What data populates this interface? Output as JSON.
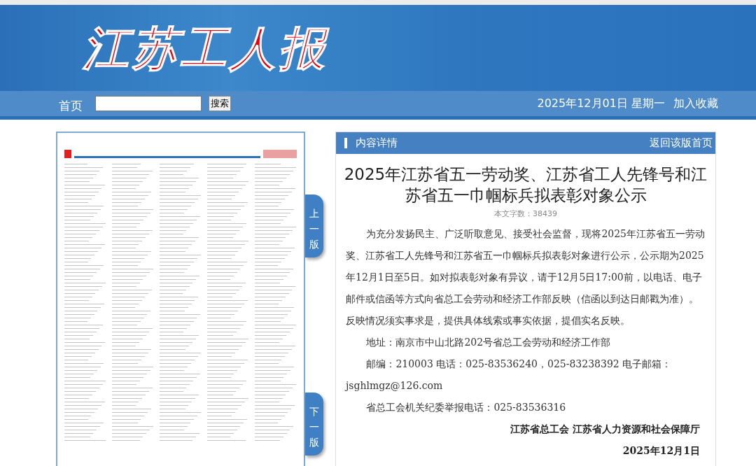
{
  "header": {
    "logo": "江苏工人报"
  },
  "nav": {
    "home": "首页",
    "search": {
      "button": "搜索"
    },
    "date": "2025年12月01日 星期一",
    "favorite": "加入收藏"
  },
  "page_nav": {
    "previous": "上一版",
    "next": "下一版"
  },
  "article": {
    "panel_title": "内容详情",
    "back_link": "返回该版首页",
    "title": "2025年江苏省五一劳动奖、江苏省工人先锋号和江苏省五一巾帼标兵拟表彰对象公示",
    "word_count": "本文字数：38439",
    "paragraphs": [
      {
        "kind": "indent",
        "text": "为充分发扬民主、广泛听取意见、接受社会监督，现将2025年江苏省五一劳动奖、江苏省工人先锋号和江苏省五一巾帼标兵拟表彰对象进行公示，公示期为2025年12月1日至5日。如对拟表彰对象有异议，请于12月5日17:00前，以电话、电子邮件或信函等方式向省总工会劳动和经济工作部反映（信函以到达日邮戳为准）。反映情况须实事求是，提供具体线索或事实依据，提倡实名反映。"
      },
      {
        "kind": "indent",
        "text": "地址：南京市中山北路202号省总工会劳动和经济工作部"
      },
      {
        "kind": "indent",
        "text": "邮编：210003 电话：025-83536240，025-83238392 电子邮箱："
      },
      {
        "kind": "plain",
        "text": "jsghlmgz@126.com"
      },
      {
        "kind": "indent",
        "text": "省总工会机关纪委举报电话：025-83536316"
      },
      {
        "kind": "signature",
        "text": "江苏省总工会 江苏省人力资源和社会保障厅"
      },
      {
        "kind": "date",
        "text": "2025年12月1日"
      }
    ]
  }
}
